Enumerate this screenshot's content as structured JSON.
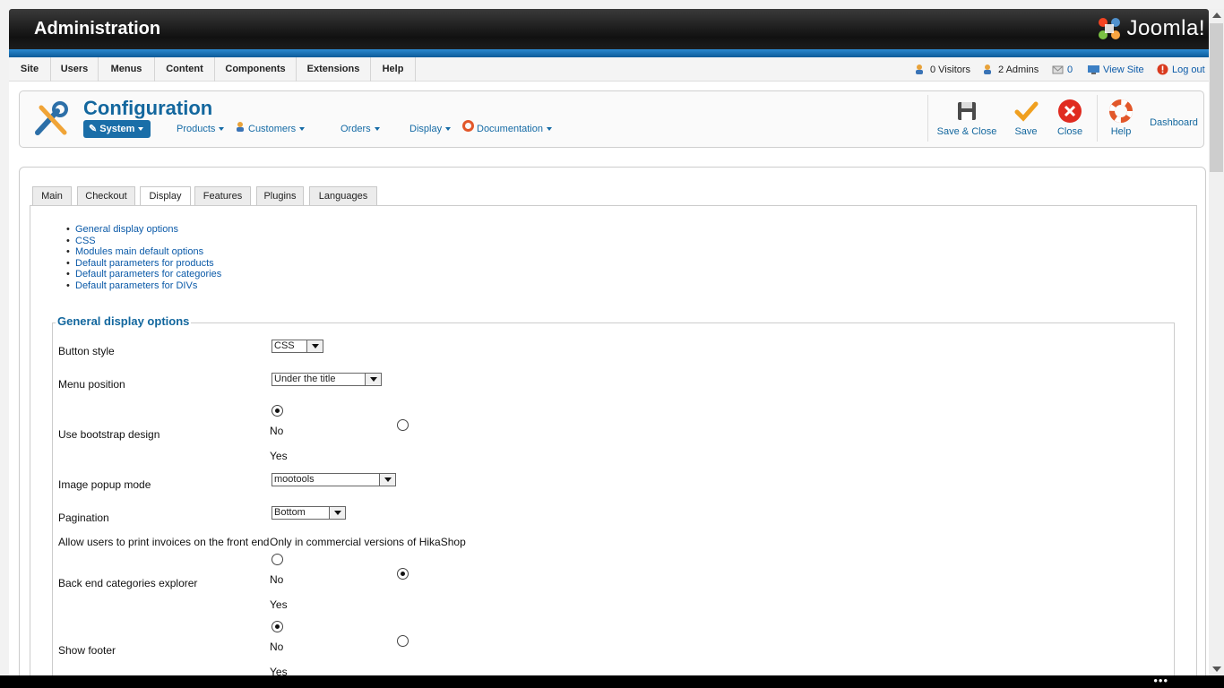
{
  "header": {
    "title": "Administration",
    "logo_text": "Joomla!"
  },
  "menu": {
    "items": [
      "Site",
      "Users",
      "Menus",
      "Content",
      "Components",
      "Extensions",
      "Help"
    ],
    "status": {
      "visitors": "0 Visitors",
      "admins": "2 Admins",
      "messages": "0",
      "view_site": "View Site",
      "logout": "Log out"
    }
  },
  "panel": {
    "title": "Configuration",
    "subnav": [
      "System",
      "Products",
      "Customers",
      "Orders",
      "Display",
      "Documentation"
    ],
    "toolbar": {
      "save_close": "Save & Close",
      "save": "Save",
      "close": "Close",
      "help": "Help",
      "dashboard": "Dashboard"
    }
  },
  "tabs": [
    "Main",
    "Checkout",
    "Display",
    "Features",
    "Plugins",
    "Languages"
  ],
  "active_tab": "Display",
  "toc": [
    "General display options",
    "CSS",
    "Modules main default options",
    "Default parameters for products",
    "Default parameters for categories",
    "Default parameters for DIVs"
  ],
  "section": {
    "legend": "General display options",
    "fields": {
      "button_style": {
        "label": "Button style",
        "value": "CSS"
      },
      "menu_position": {
        "label": "Menu position",
        "value": "Under the title"
      },
      "bootstrap": {
        "label": "Use bootstrap design",
        "no": "No",
        "yes": "Yes",
        "selected": "No"
      },
      "image_popup": {
        "label": "Image popup mode",
        "value": "mootools"
      },
      "pagination": {
        "label": "Pagination",
        "value": "Bottom"
      },
      "print_invoices": {
        "label": "Allow users to print invoices on the front end",
        "note": "Only in commercial versions of HikaShop"
      },
      "categories_explorer": {
        "label": "Back end categories explorer",
        "no": "No",
        "yes": "Yes",
        "selected": "Yes"
      },
      "show_footer": {
        "label": "Show footer",
        "no": "No",
        "yes": "Yes",
        "selected": "No"
      }
    }
  },
  "colors": {
    "accent": "#13679e",
    "link": "#0b5aa8",
    "header_bg": "#1a1a1a",
    "blue_bar": "#0c5a99"
  }
}
